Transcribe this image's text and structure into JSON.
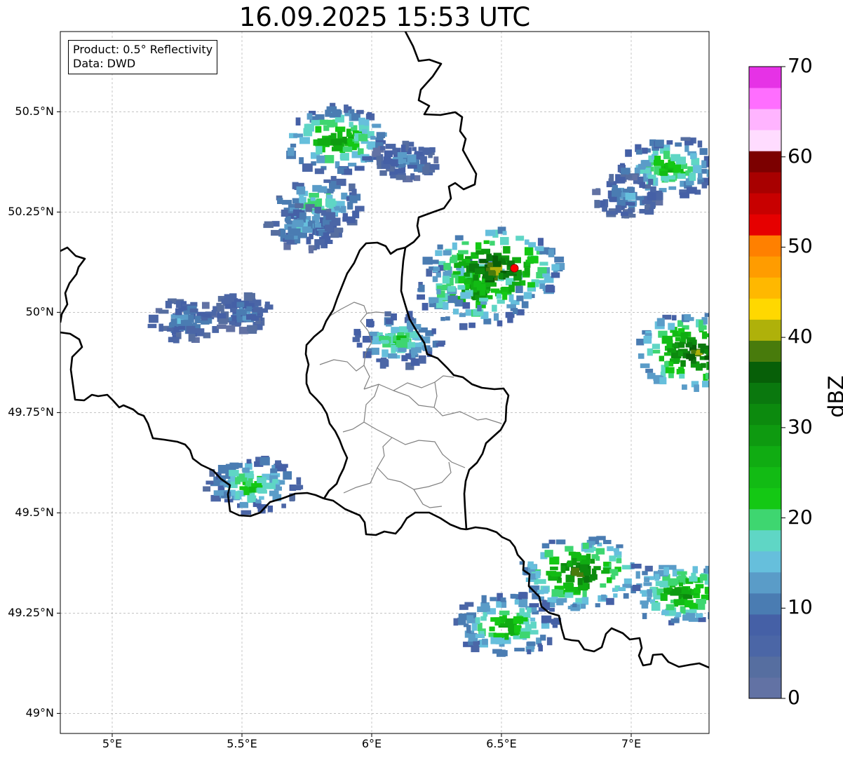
{
  "title": "16.09.2025 15:53 UTC",
  "info": {
    "product": "Product: 0.5° Reflectivity",
    "data_source": "Data: DWD"
  },
  "map": {
    "lon_range": [
      4.8,
      7.3
    ],
    "lat_range": [
      48.95,
      50.7
    ],
    "grid": true,
    "x_ticks": [
      {
        "value": 5.0,
        "label": "5°E"
      },
      {
        "value": 5.5,
        "label": "5.5°E"
      },
      {
        "value": 6.0,
        "label": "6°E"
      },
      {
        "value": 6.5,
        "label": "6.5°E"
      },
      {
        "value": 7.0,
        "label": "7°E"
      }
    ],
    "y_ticks": [
      {
        "value": 50.5,
        "label": "50.5°N"
      },
      {
        "value": 50.25,
        "label": "50.25°N"
      },
      {
        "value": 50.0,
        "label": "50°N"
      },
      {
        "value": 49.75,
        "label": "49.75°N"
      },
      {
        "value": 49.5,
        "label": "49.5°N"
      },
      {
        "value": 49.25,
        "label": "49.25°N"
      },
      {
        "value": 49.0,
        "label": "49°N"
      }
    ],
    "radar_site": {
      "lon": 6.55,
      "lat": 50.11,
      "color": "#ff0000"
    },
    "colors": {
      "border": "#000000",
      "admin": "#808080",
      "grid": "#b0b0b0"
    }
  },
  "colorbar": {
    "title": "dBZ",
    "min": 0,
    "max": 70,
    "step": 2.5,
    "ticks": [
      {
        "value": 0,
        "label": "0"
      },
      {
        "value": 10,
        "label": "10"
      },
      {
        "value": 20,
        "label": "20"
      },
      {
        "value": 30,
        "label": "30"
      },
      {
        "value": 40,
        "label": "40"
      },
      {
        "value": 50,
        "label": "50"
      },
      {
        "value": 60,
        "label": "60"
      },
      {
        "value": 70,
        "label": "70"
      }
    ],
    "colors": [
      "#6272a4",
      "#566ea0",
      "#4b66a6",
      "#4560a6",
      "#4a7cb2",
      "#5a9cc8",
      "#66bfdc",
      "#5fd6c5",
      "#3ed670",
      "#14c814",
      "#12bb14",
      "#10ac12",
      "#0e9a10",
      "#0c8a0e",
      "#0a780e",
      "#075f08",
      "#487b0c",
      "#afb10a",
      "#ffd800",
      "#ffb800",
      "#ff9c00",
      "#ff8000",
      "#e60000",
      "#c80000",
      "#a80000",
      "#7c0000",
      "#ffdcff",
      "#ffb4ff",
      "#ff6eff",
      "#e632e6"
    ]
  },
  "chart_data": {
    "type": "heatmap",
    "title": "16.09.2025 15:53 UTC",
    "value_label": "dBZ",
    "value_range": [
      0,
      70
    ],
    "cells": [
      {
        "lon": 5.8,
        "lat": 50.27,
        "dbz": 22
      },
      {
        "lon": 5.86,
        "lat": 50.43,
        "dbz": 30
      },
      {
        "lon": 5.74,
        "lat": 50.21,
        "dbz": 16
      },
      {
        "lon": 6.13,
        "lat": 50.38,
        "dbz": 12
      },
      {
        "lon": 6.4,
        "lat": 50.05,
        "dbz": 32
      },
      {
        "lon": 6.47,
        "lat": 50.11,
        "dbz": 40
      },
      {
        "lon": 6.1,
        "lat": 49.93,
        "dbz": 22
      },
      {
        "lon": 7.15,
        "lat": 50.36,
        "dbz": 26
      },
      {
        "lon": 6.98,
        "lat": 50.29,
        "dbz": 14
      },
      {
        "lon": 7.25,
        "lat": 49.9,
        "dbz": 38
      },
      {
        "lon": 5.54,
        "lat": 49.57,
        "dbz": 24
      },
      {
        "lon": 6.8,
        "lat": 49.35,
        "dbz": 36
      },
      {
        "lon": 6.52,
        "lat": 49.22,
        "dbz": 28
      },
      {
        "lon": 7.2,
        "lat": 49.3,
        "dbz": 30
      },
      {
        "lon": 5.28,
        "lat": 49.98,
        "dbz": 14
      },
      {
        "lon": 5.5,
        "lat": 50.0,
        "dbz": 12
      }
    ]
  }
}
